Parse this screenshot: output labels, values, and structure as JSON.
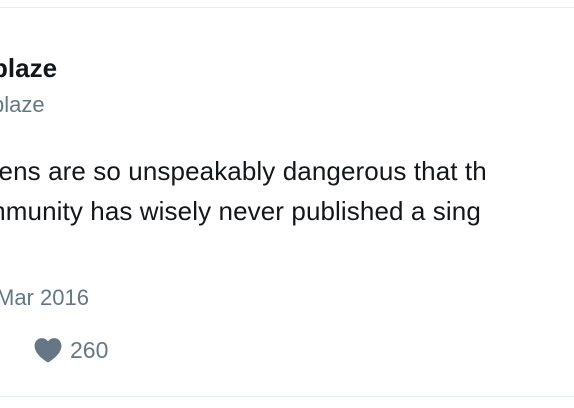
{
  "tweet": {
    "display_name": "blaze",
    "handle": "blaze",
    "text_lines": [
      "gens are so unspeakably dangerous that th",
      "mmunity has wisely never published a sing"
    ],
    "timestamp": "Mar 2016",
    "like_count": "260",
    "like_icon": "heart-icon"
  },
  "colors": {
    "text_primary": "#14171a",
    "text_secondary": "#657786",
    "border": "#e6ecf0"
  }
}
